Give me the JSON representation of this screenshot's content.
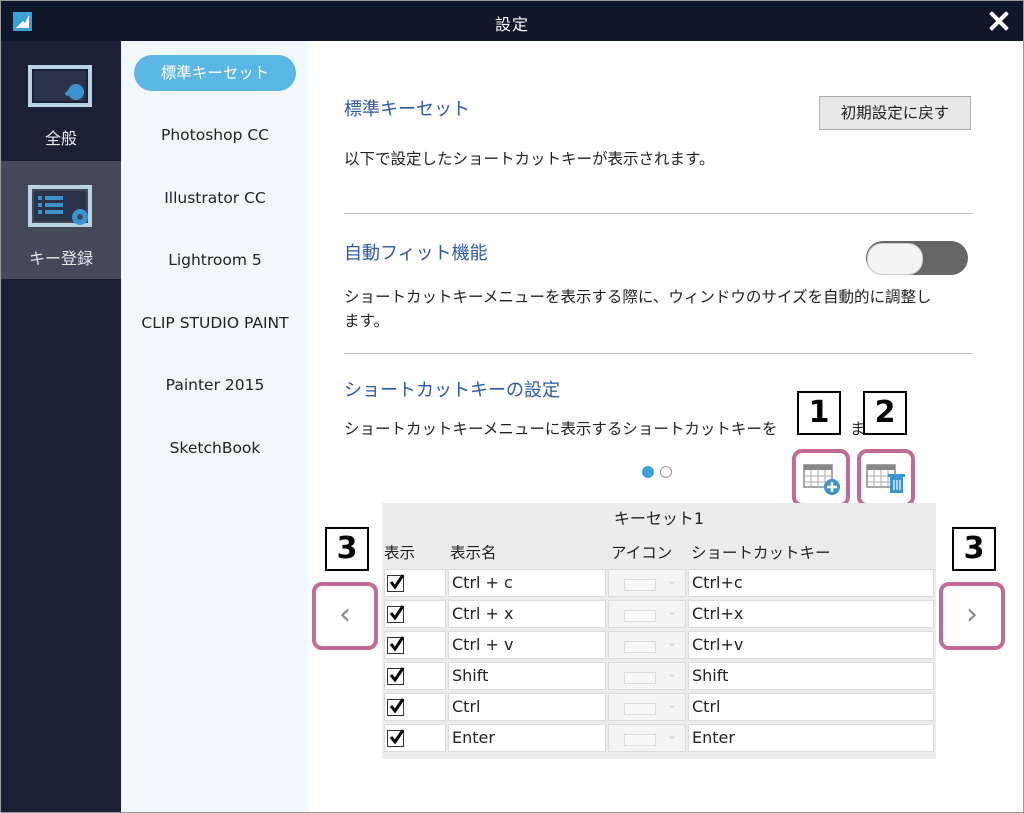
{
  "window": {
    "title": "設定"
  },
  "nav": {
    "items": [
      {
        "label": "全般",
        "icon": "general-settings-icon"
      },
      {
        "label": "キー登録",
        "icon": "key-registration-icon"
      }
    ]
  },
  "keysets": [
    "標準キーセット",
    "Photoshop CC",
    "Illustrator CC",
    "Lightroom 5",
    "CLIP STUDIO PAINT",
    "Painter 2015",
    "SketchBook"
  ],
  "main": {
    "section1_title": "標準キーセット",
    "section1_desc": "以下で設定したショートカットキーが表示されます。",
    "reset_button": "初期設定に戻す",
    "section2_title": "自動フィット機能",
    "section2_desc_line1": "ショートカットキーメニューを表示する際に、ウィンドウのサイズを自動的に調整し",
    "section2_desc_line2": "ます。",
    "auto_fit_on": false,
    "section3_title": "ショートカットキーの設定",
    "section3_desc_a": "ショートカットキーメニューに表示するショートカットキーを",
    "section3_desc_b": "ま",
    "callouts": [
      "1",
      "2",
      "3",
      "3"
    ],
    "page_count": 2,
    "current_page": 1
  },
  "table": {
    "title": "キーセット1",
    "headers": [
      "表示",
      "表示名",
      "アイコン",
      "ショートカットキー"
    ],
    "rows": [
      {
        "show": true,
        "name": "Ctrl + c",
        "shortcut": "Ctrl+c"
      },
      {
        "show": true,
        "name": "Ctrl + x",
        "shortcut": "Ctrl+x"
      },
      {
        "show": true,
        "name": "Ctrl + v",
        "shortcut": "Ctrl+v"
      },
      {
        "show": true,
        "name": "Shift",
        "shortcut": "Shift"
      },
      {
        "show": true,
        "name": "Ctrl",
        "shortcut": "Ctrl"
      },
      {
        "show": true,
        "name": "Enter",
        "shortcut": "Enter"
      }
    ]
  },
  "colors": {
    "accent": "#5ab6e4",
    "highlight": "#c36b96",
    "nav_bg": "#1a2134",
    "title_blue": "#2a5aa8"
  }
}
